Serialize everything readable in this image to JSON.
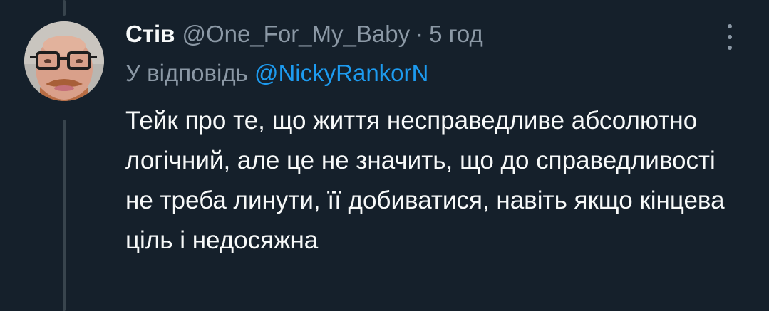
{
  "tweet": {
    "display_name": "Стів",
    "handle": "@One_For_My_Baby",
    "separator": "·",
    "time": "5 год",
    "reply_prefix": "У відповідь",
    "reply_to": "@NickyRankorN",
    "text": "Тейк про те, що життя несправедливе абсолютно логічний, але це не значить, що до справедливості не треба линути, її добиватися, навіть якщо кінцева ціль і недосяжна"
  },
  "icons": {
    "avatar": "avatar-photo",
    "more": "more-vertical-icon"
  },
  "colors": {
    "background": "#15202b",
    "primary_text": "#f7f9f9",
    "secondary_text": "#8b98a5",
    "link": "#1d9bf0",
    "thread_line": "#38444d"
  }
}
